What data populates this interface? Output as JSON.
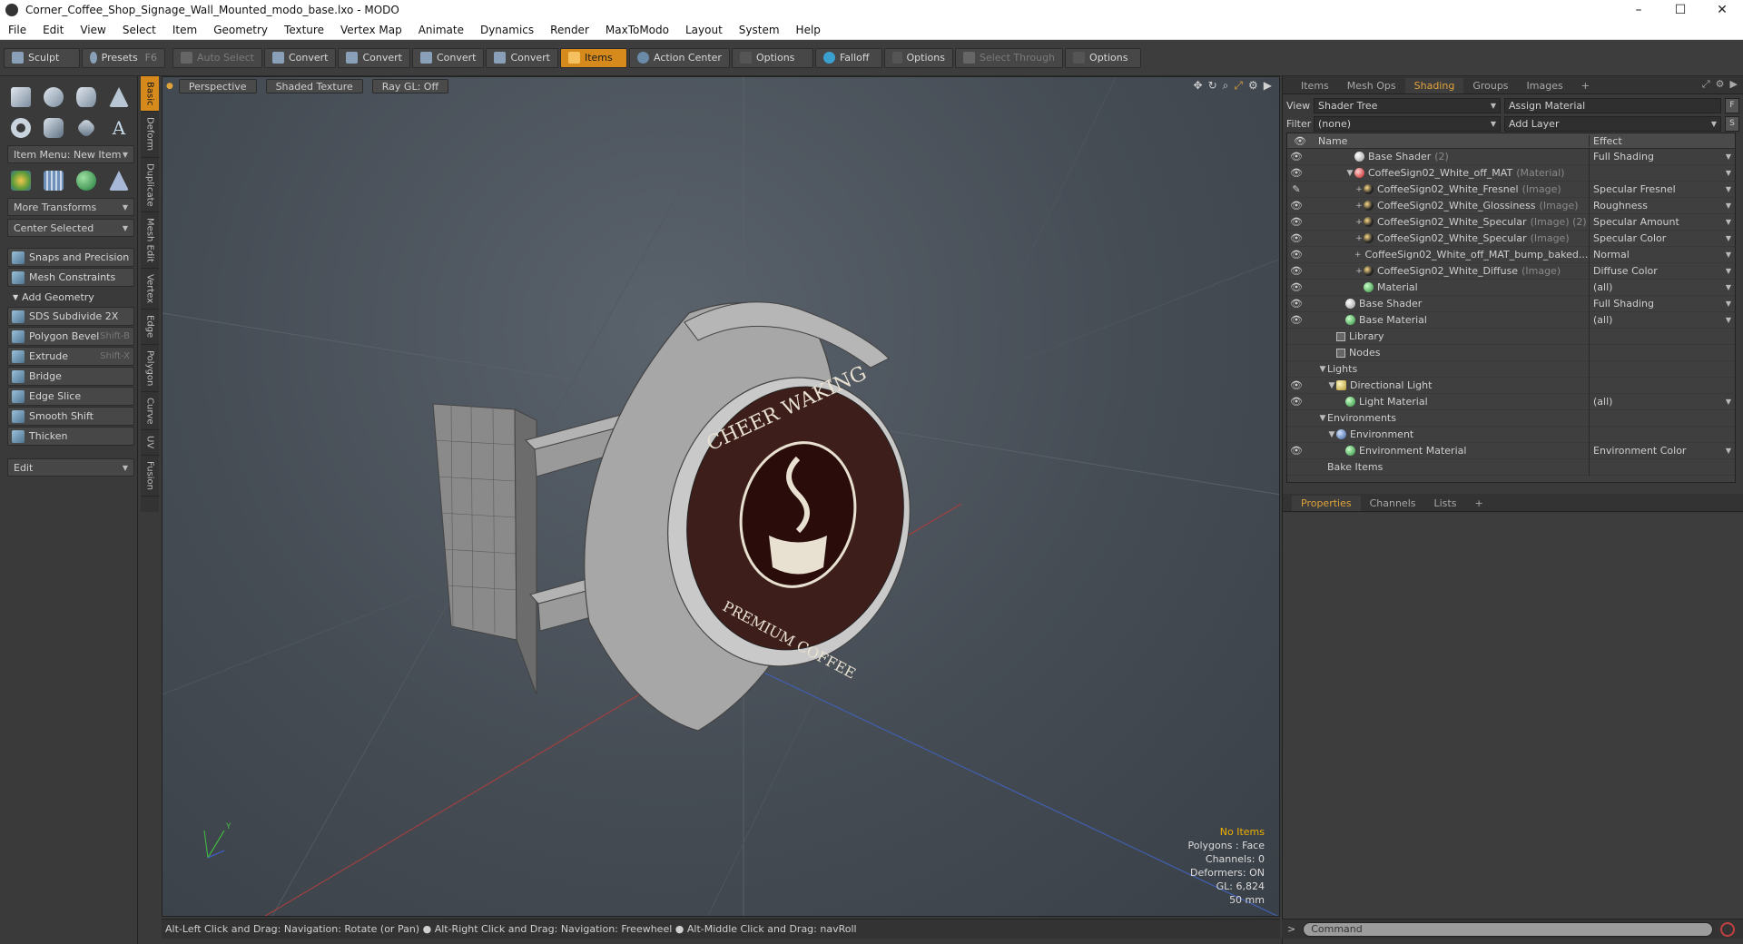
{
  "window": {
    "title": "Corner_Coffee_Shop_Signage_Wall_Mounted_modo_base.lxo - MODO",
    "controls": [
      "–",
      "☐",
      "✕"
    ]
  },
  "menu": [
    "File",
    "Edit",
    "View",
    "Select",
    "Item",
    "Geometry",
    "Texture",
    "Vertex Map",
    "Animate",
    "Dynamics",
    "Render",
    "MaxToModo",
    "Layout",
    "System",
    "Help"
  ],
  "toolbar": {
    "sculpt": "Sculpt",
    "presets": "Presets",
    "presets_shortcut": "F6",
    "auto_select": "Auto Select",
    "convert1": "Convert",
    "convert2": "Convert",
    "convert3": "Convert",
    "convert4": "Convert",
    "items": "Items",
    "action_center": "Action Center",
    "options1": "Options",
    "falloff": "Falloff",
    "options2": "Options",
    "select_through": "Select Through",
    "options3": "Options"
  },
  "left_panel": {
    "item_menu": "Item Menu: New Item",
    "more_transforms": "More Transforms",
    "center_selected": "Center Selected",
    "snaps": "Snaps and Precision",
    "mesh_constraints": "Mesh Constraints",
    "add_geometry": "Add Geometry",
    "tools": [
      {
        "label": "SDS Subdivide 2X",
        "shortcut": ""
      },
      {
        "label": "Polygon Bevel",
        "shortcut": "Shift-B"
      },
      {
        "label": "Extrude",
        "shortcut": "Shift-X"
      },
      {
        "label": "Bridge",
        "shortcut": ""
      },
      {
        "label": "Edge Slice",
        "shortcut": ""
      },
      {
        "label": "Smooth Shift",
        "shortcut": ""
      },
      {
        "label": "Thicken",
        "shortcut": ""
      }
    ],
    "edit_drop": "Edit",
    "side_tabs": [
      "Basic",
      "Deform",
      "Duplicate",
      "Mesh Edit",
      "Vertex",
      "Edge",
      "Polygon",
      "Curve",
      "UV",
      "Fusion"
    ]
  },
  "viewport": {
    "view_mode": "Perspective",
    "shading": "Shaded Texture",
    "raygl": "Ray GL: Off",
    "info": {
      "items": "No Items",
      "polygons": "Polygons : Face",
      "channels": "Channels: 0",
      "deformers": "Deformers: ON",
      "gl": "GL: 6,824",
      "scale": "50 mm"
    },
    "sign_text_top": "CHEER WAKING",
    "sign_text_bottom": "PREMIUM COFFEE"
  },
  "status": "Alt-Left Click and Drag: Navigation: Rotate (or Pan) ● Alt-Right Click and Drag: Navigation: Freewheel ● Alt-Middle Click and Drag: navRoll",
  "right_panel": {
    "tabs": [
      "Items",
      "Mesh Ops",
      "Shading",
      "Groups",
      "Images",
      "+"
    ],
    "active_tab": "Shading",
    "view_label": "View",
    "view_value": "Shader Tree",
    "assign_material": "Assign Material",
    "filter_label": "Filter",
    "filter_value": "(none)",
    "add_layer": "Add Layer",
    "col_name": "Name",
    "col_effect": "Effect",
    "rows": [
      {
        "indent": 3,
        "icon": "ico-shader",
        "name": "Base Shader",
        "type": "(2)",
        "effect": "Full Shading",
        "eye": "👁",
        "tw": ""
      },
      {
        "indent": 3,
        "icon": "ico-mat",
        "name": "CoffeeSign02_White_off_MAT",
        "type": "(Material)",
        "effect": "",
        "eye": "👁",
        "tw": "▼"
      },
      {
        "indent": 4,
        "icon": "ico-img",
        "name": "CoffeeSign02_White_Fresnel",
        "type": "(Image)",
        "effect": "Specular Fresnel",
        "eye": "✎",
        "tw": "+"
      },
      {
        "indent": 4,
        "icon": "ico-img",
        "name": "CoffeeSign02_White_Glossiness",
        "type": "(Image)",
        "effect": "Roughness",
        "eye": "👁",
        "tw": "+"
      },
      {
        "indent": 4,
        "icon": "ico-img",
        "name": "CoffeeSign02_White_Specular",
        "type": "(Image) (2)",
        "effect": "Specular Amount",
        "eye": "👁",
        "tw": "+"
      },
      {
        "indent": 4,
        "icon": "ico-img",
        "name": "CoffeeSign02_White_Specular",
        "type": "(Image)",
        "effect": "Specular Color",
        "eye": "👁",
        "tw": "+"
      },
      {
        "indent": 4,
        "icon": "ico-img",
        "name": "CoffeeSign02_White_off_MAT_bump_baked...",
        "type": "",
        "effect": "Normal",
        "eye": "👁",
        "tw": "+"
      },
      {
        "indent": 4,
        "icon": "ico-img",
        "name": "CoffeeSign02_White_Diffuse",
        "type": "(Image)",
        "effect": "Diffuse Color",
        "eye": "👁",
        "tw": "+"
      },
      {
        "indent": 4,
        "icon": "ico-green",
        "name": "Material",
        "type": "",
        "effect": "(all)",
        "eye": "👁",
        "tw": ""
      },
      {
        "indent": 2,
        "icon": "ico-shader",
        "name": "Base Shader",
        "type": "",
        "effect": "Full Shading",
        "eye": "👁",
        "tw": ""
      },
      {
        "indent": 2,
        "icon": "ico-green",
        "name": "Base Material",
        "type": "",
        "effect": "(all)",
        "eye": "👁",
        "tw": ""
      },
      {
        "indent": 1,
        "icon": "ico-folder",
        "name": "Library",
        "type": "",
        "effect": "",
        "eye": "",
        "tw": ""
      },
      {
        "indent": 1,
        "icon": "ico-folder",
        "name": "Nodes",
        "type": "",
        "effect": "",
        "eye": "",
        "tw": ""
      },
      {
        "indent": 0,
        "icon": "",
        "name": "Lights",
        "type": "",
        "effect": "",
        "eye": "",
        "tw": "▼"
      },
      {
        "indent": 1,
        "icon": "ico-light",
        "name": "Directional Light",
        "type": "",
        "effect": "",
        "eye": "👁",
        "tw": "▼"
      },
      {
        "indent": 2,
        "icon": "ico-green",
        "name": "Light Material",
        "type": "",
        "effect": "(all)",
        "eye": "👁",
        "tw": ""
      },
      {
        "indent": 0,
        "icon": "",
        "name": "Environments",
        "type": "",
        "effect": "",
        "eye": "",
        "tw": "▼"
      },
      {
        "indent": 1,
        "icon": "ico-env",
        "name": "Environment",
        "type": "",
        "effect": "",
        "eye": "",
        "tw": "▼"
      },
      {
        "indent": 2,
        "icon": "ico-green",
        "name": "Environment Material",
        "type": "",
        "effect": "Environment Color",
        "eye": "👁",
        "tw": ""
      },
      {
        "indent": 0,
        "icon": "",
        "name": "Bake Items",
        "type": "",
        "effect": "",
        "eye": "",
        "tw": ""
      }
    ],
    "props_tabs": [
      "Properties",
      "Channels",
      "Lists",
      "+"
    ],
    "command_placeholder": "Command"
  }
}
